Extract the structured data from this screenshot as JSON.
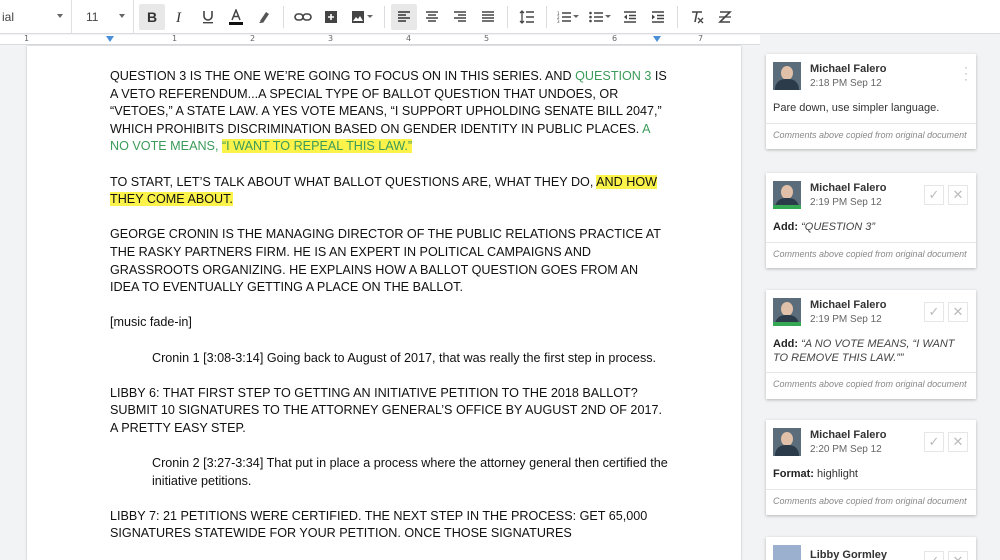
{
  "toolbar": {
    "font_name": "ial",
    "font_size": "11",
    "icons": [
      "bold-icon",
      "italic-icon",
      "underline-icon",
      "text-color-icon",
      "highlight-icon",
      "link-icon",
      "comment-icon",
      "image-icon",
      "align-left-icon",
      "align-center-icon",
      "align-right-icon",
      "justify-icon",
      "line-spacing-icon",
      "numbered-list-icon",
      "bulleted-list-icon",
      "decrease-indent-icon",
      "increase-indent-icon",
      "clear-formatting-icon",
      "strikethrough-icon"
    ]
  },
  "ruler": {
    "numbers": [
      "1",
      "1",
      "2",
      "3",
      "4",
      "5",
      "6",
      "7"
    ]
  },
  "document": {
    "p1": {
      "a": "QUESTION 3 IS THE ONE WE’RE GOING TO FOCUS ON IN THIS SERIES. AND ",
      "b": "QUESTION 3",
      "c": " IS A VETO REFERENDUM...A SPECIAL TYPE OF BALLOT QUESTION THAT UNDOES, OR “VETOES,” A STATE LAW. A YES VOTE MEANS, “I SUPPORT UPHOLDING SENATE BILL 2047,” WHICH PROHIBITS DISCRIMINATION BASED ON GENDER IDENTITY IN PUBLIC PLACES. ",
      "d": "A NO VOTE MEANS, ",
      "e": "“I WANT TO REPEAL THIS LAW.”"
    },
    "p2": {
      "a": "TO START, LET’S TALK ABOUT WHAT BALLOT QUESTIONS ARE, WHAT THEY DO, ",
      "b": "AND HOW THEY COME ABOUT."
    },
    "p3": "GEORGE CRONIN IS THE MANAGING DIRECTOR OF THE PUBLIC RELATIONS PRACTICE AT THE RASKY PARTNERS FIRM. HE IS AN EXPERT IN POLITICAL CAMPAIGNS AND GRASSROOTS ORGANIZING. HE EXPLAINS HOW A BALLOT QUESTION GOES FROM AN IDEA TO EVENTUALLY GETTING A PLACE ON THE BALLOT.",
    "p4": "[music fade-in]",
    "p5": "Cronin 1 [3:08-3:14] Going back to August of 2017, that was really the first step in process.",
    "p6": "LIBBY 6: THAT FIRST STEP TO GETTING AN INITIATIVE PETITION TO THE 2018 BALLOT? SUBMIT 10 SIGNATURES TO THE ATTORNEY GENERAL’S OFFICE BY AUGUST 2ND OF 2017. A PRETTY EASY STEP.",
    "p7": "Cronin 2 [3:27-3:34] That put in place a process where the attorney general then certified the initiative petitions.",
    "p8": "LIBBY 7: 21 PETITIONS WERE CERTIFIED. THE NEXT STEP  IN THE PROCESS: GET 65,000 SIGNATURES STATEWIDE FOR YOUR PETITION. ONCE THOSE SIGNATURES"
  },
  "comments": [
    {
      "author": "Michael Falero",
      "time": "2:18 PM Sep 12",
      "label": "",
      "text": "Pare down, use simpler language.",
      "footer": "Comments above copied from original document"
    },
    {
      "author": "Michael Falero",
      "time": "2:19 PM Sep 12",
      "label": "Add:",
      "text": "“QUESTION 3”",
      "footer": "Comments above copied from original document"
    },
    {
      "author": "Michael Falero",
      "time": "2:19 PM Sep 12",
      "label": "Add:",
      "text": "“A NO VOTE MEANS, “I WANT TO REMOVE THIS LAW.””",
      "footer": "Comments above copied from original document"
    },
    {
      "author": "Michael Falero",
      "time": "2:20 PM Sep 12",
      "label": "Format:",
      "text": "highlight",
      "footer": "Comments above copied from original document"
    },
    {
      "author": "Libby Gormley"
    }
  ],
  "colors": {
    "suggestion_green": "#3b9b59",
    "highlight_yellow": "#fbf34a",
    "avatar_green": "#34a853"
  }
}
